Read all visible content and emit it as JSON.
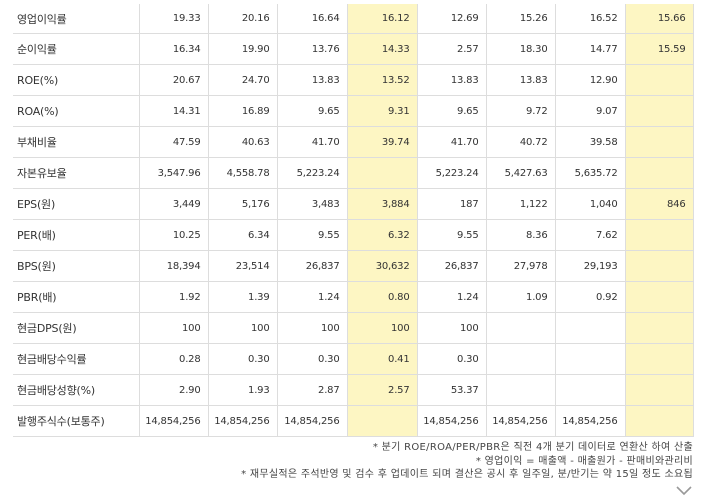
{
  "rows": [
    {
      "label": "영업이익률",
      "values": [
        "19.33",
        "20.16",
        "16.64",
        "16.12",
        "12.69",
        "15.26",
        "16.52",
        "15.66"
      ]
    },
    {
      "label": "순이익률",
      "values": [
        "16.34",
        "19.90",
        "13.76",
        "14.33",
        "2.57",
        "18.30",
        "14.77",
        "15.59"
      ]
    },
    {
      "label": "ROE(%)",
      "values": [
        "20.67",
        "24.70",
        "13.83",
        "13.52",
        "13.83",
        "13.83",
        "12.90",
        ""
      ]
    },
    {
      "label": "ROA(%)",
      "values": [
        "14.31",
        "16.89",
        "9.65",
        "9.31",
        "9.65",
        "9.72",
        "9.07",
        ""
      ]
    },
    {
      "label": "부채비율",
      "values": [
        "47.59",
        "40.63",
        "41.70",
        "39.74",
        "41.70",
        "40.72",
        "39.58",
        ""
      ]
    },
    {
      "label": "자본유보율",
      "values": [
        "3,547.96",
        "4,558.78",
        "5,223.24",
        "",
        "5,223.24",
        "5,427.63",
        "5,635.72",
        ""
      ]
    },
    {
      "label": "EPS(원)",
      "values": [
        "3,449",
        "5,176",
        "3,483",
        "3,884",
        "187",
        "1,122",
        "1,040",
        "846"
      ]
    },
    {
      "label": "PER(배)",
      "values": [
        "10.25",
        "6.34",
        "9.55",
        "6.32",
        "9.55",
        "8.36",
        "7.62",
        ""
      ]
    },
    {
      "label": "BPS(원)",
      "values": [
        "18,394",
        "23,514",
        "26,837",
        "30,632",
        "26,837",
        "27,978",
        "29,193",
        ""
      ]
    },
    {
      "label": "PBR(배)",
      "values": [
        "1.92",
        "1.39",
        "1.24",
        "0.80",
        "1.24",
        "1.09",
        "0.92",
        ""
      ]
    },
    {
      "label": "현금DPS(원)",
      "values": [
        "100",
        "100",
        "100",
        "100",
        "100",
        "",
        "",
        ""
      ]
    },
    {
      "label": "현금배당수익률",
      "values": [
        "0.28",
        "0.30",
        "0.30",
        "0.41",
        "0.30",
        "",
        "",
        ""
      ]
    },
    {
      "label": "현금배당성향(%)",
      "values": [
        "2.90",
        "1.93",
        "2.87",
        "2.57",
        "53.37",
        "",
        "",
        ""
      ]
    },
    {
      "label": "발행주식수(보통주)",
      "values": [
        "14,854,256",
        "14,854,256",
        "14,854,256",
        "",
        "14,854,256",
        "14,854,256",
        "14,854,256",
        ""
      ]
    }
  ],
  "highlight_columns": [
    3,
    7
  ],
  "highlight_color": "#fdf6c3",
  "notes": [
    "* 분기 ROE/ROA/PER/PBR은 직전 4개 분기 데이터로 연환산 하여 산출",
    "* 영업이익 = 매출액 - 매출원가 - 판매비와관리비",
    "* 재무실적은 주석반영 및 검수 후 업데이트 되며 결산은 공시 후 일주일, 분/반기는 약 15일 정도 소요됩"
  ],
  "icons": {
    "expand": "chevron-down-icon"
  }
}
